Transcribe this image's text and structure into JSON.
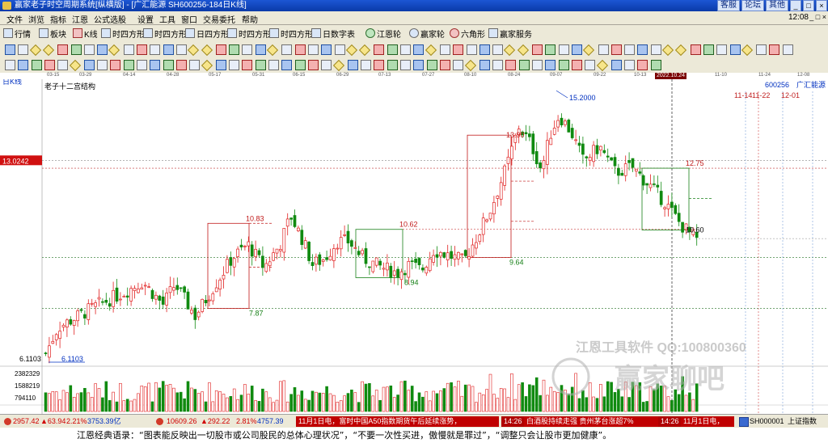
{
  "window": {
    "title": "赢家老子时空周期系统[纵横版] - [广汇能源  SH600256-184日K线]",
    "right_links": [
      "客服",
      "论坛",
      "其他"
    ],
    "controls": [
      "_",
      "□",
      "×"
    ]
  },
  "menu": {
    "items": [
      "文件",
      "浏览",
      "指标",
      "江恩",
      "公式选股",
      "设置",
      "工具",
      "窗口",
      "交易委托",
      "帮助"
    ],
    "right": "12:08",
    "mdi_controls": "_ □ ×"
  },
  "toolbar1": {
    "items": [
      "行情",
      "板块",
      "K线",
      "时四方形",
      "时四方形",
      "日四方形",
      "时四方形",
      "时四方形",
      "日数字表",
      "江恩轮",
      "赢家轮",
      "六角形",
      "赢家服务"
    ]
  },
  "chart_top": {
    "period_label": "日K线",
    "structure_label": "老子十二宫结构",
    "stock_code": "600256",
    "stock_name": "广汇能源",
    "highlight_date": "2022.10.24",
    "date_ticks": [
      "03-15",
      "03-29",
      "04-14",
      "04-28",
      "05-17",
      "05-31",
      "06-15",
      "06-29",
      "07-13",
      "07-27",
      "08-10",
      "08-24",
      "09-07",
      "09-22",
      "10-13",
      "10-24",
      "11-10",
      "11-24",
      "12-08"
    ],
    "future_dates": [
      "11-14",
      "11-22",
      "12-01"
    ],
    "price_cursor": "13.0242"
  },
  "chart_data": {
    "type": "candlestick",
    "price_range": [
      5.6,
      15.9
    ],
    "annotations": [
      {
        "label": "15.2000",
        "price": 15.2
      },
      {
        "label": "13.90",
        "price": 13.9
      },
      {
        "label": "12.75",
        "price": 12.75
      },
      {
        "label": "10.83",
        "price": 10.83
      },
      {
        "label": "10.62",
        "price": 10.62
      },
      {
        "label": "10.60",
        "price": 10.6
      },
      {
        "label": "9.64",
        "price": 9.64
      },
      {
        "label": "8.94",
        "price": 8.94
      },
      {
        "label": "7.87",
        "price": 7.87
      },
      {
        "label": "6.1103",
        "price": 6.1103
      }
    ],
    "axis_labels": {
      "left_price": "6.1103"
    },
    "volume_ticks": [
      "2382329",
      "1588219",
      "794110"
    ]
  },
  "watermark": {
    "company": "江恩工具软件  QQ:100800360",
    "brand": "赢家聊吧"
  },
  "status": {
    "idx1": "2957.42",
    "idx1_chg": "▲63.94",
    "idx1_pct": "2.21%",
    "idx1_amt": "3753.39亿",
    "idx2": "10609.26",
    "idx2_chg": "▲292.22",
    "idx2_pct": "2.81%",
    "idx2_amt": "4757.39",
    "news1": "11月1日电，富时中国A50指数期货午后延续涨势，",
    "news2_time": "14:26",
    "news2": "白酒股持续走强 贵州茅台涨超7%",
    "news3_time": "14:26",
    "news3": "11月1日电，",
    "index_code": "SH000001",
    "index_name": "上证指数"
  },
  "bottom_quote": "江恩经典语录：“图表能反映出一切股市或公司股民的总体心理状况”，“不要一次性买进，傲慢就是罪过”，“调整只会让股市更加健康”。"
}
